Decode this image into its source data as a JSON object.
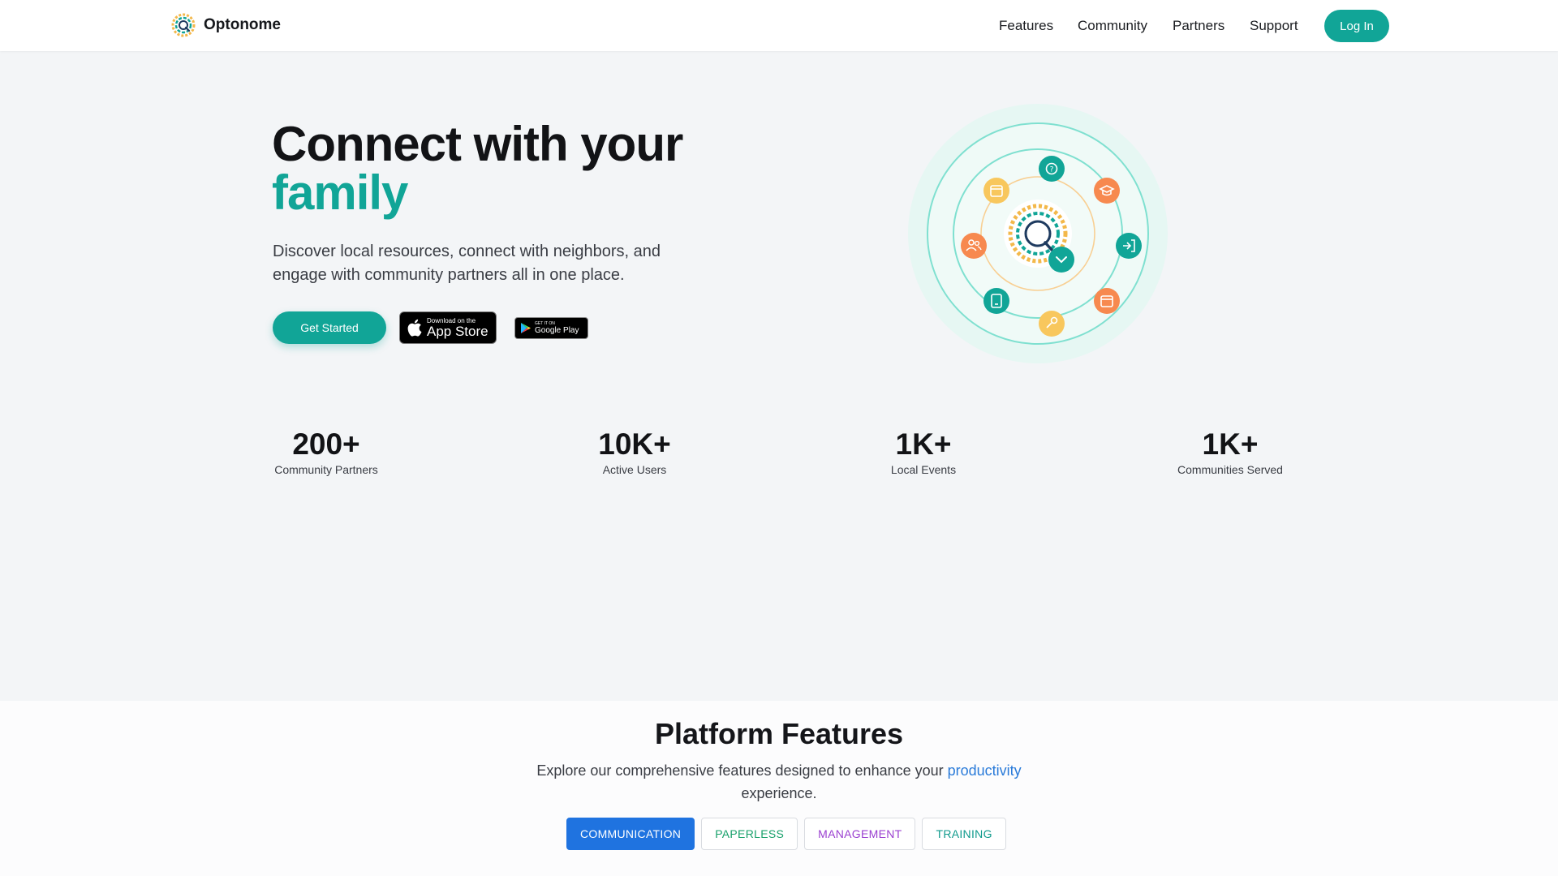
{
  "brand": {
    "name": "Optonome"
  },
  "nav": {
    "links": [
      "Features",
      "Community",
      "Partners",
      "Support"
    ],
    "login_label": "Log In"
  },
  "hero": {
    "title_line1": "Connect with your",
    "title_accent": "family",
    "subtitle": "Discover local resources, connect with neighbors, and engage with community partners all in one place.",
    "primary_cta": "Get Started",
    "app_store": {
      "small": "Download on the",
      "big": "App Store"
    },
    "google_play": {
      "small": "GET IT ON",
      "big": "Google Play"
    }
  },
  "stats": [
    {
      "value": "200+",
      "label": "Community Partners"
    },
    {
      "value": "10K+",
      "label": "Active Users"
    },
    {
      "value": "1K+",
      "label": "Local Events"
    },
    {
      "value": "1K+",
      "label": "Communities Served"
    }
  ],
  "features": {
    "title": "Platform Features",
    "subtitle_before": "Explore our comprehensive features designed to enhance your ",
    "subtitle_link": "productivity",
    "subtitle_after": " experience.",
    "tabs": [
      "COMMUNICATION",
      "PAPERLESS",
      "MANAGEMENT",
      "TRAINING"
    ]
  },
  "colors": {
    "brand_teal": "#11a597",
    "accent_orange": "#f7894f",
    "accent_yellow": "#f8c75d",
    "tab_active_blue": "#1f73e0"
  },
  "icons": {
    "orbit": [
      "help-icon",
      "graduation-cap-icon",
      "login-arrow-icon",
      "calendar-icon",
      "key-icon",
      "tablet-icon",
      "users-icon",
      "calendar-icon",
      "chevron-down-icon"
    ]
  }
}
